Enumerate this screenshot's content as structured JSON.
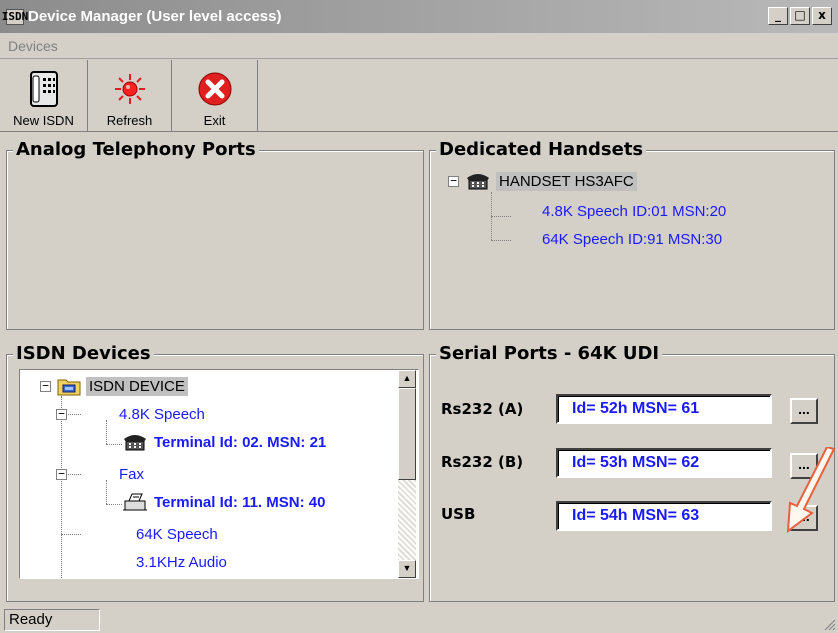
{
  "window": {
    "title": "Device Manager (User level access)",
    "app_icon": "ISDN",
    "controls": {
      "minimize": "_",
      "maximize": "□",
      "close": "x"
    }
  },
  "menu": {
    "items": [
      "Devices"
    ]
  },
  "toolbar": {
    "new_isdn": "New ISDN",
    "refresh": "Refresh",
    "exit": "Exit"
  },
  "analog": {
    "title": "Analog Telephony Ports"
  },
  "handsets": {
    "title": "Dedicated Handsets",
    "root": "HANDSET HS3AFC",
    "children": [
      "4.8K Speech ID:01 MSN:20",
      "64K Speech ID:91 MSN:30"
    ]
  },
  "isdn": {
    "title": "ISDN Devices",
    "root": "ISDN DEVICE",
    "items": [
      "4.8K Speech",
      "Terminal Id: 02.  MSN: 21",
      "Fax",
      "Terminal Id: 11.  MSN: 40",
      "64K Speech",
      "3.1KHz Audio"
    ]
  },
  "serial": {
    "title": "Serial Ports - 64K UDI",
    "ports": [
      {
        "label": "Rs232 (A)",
        "value": "Id= 52h  MSN= 61",
        "button": "..."
      },
      {
        "label": "Rs232 (B)",
        "value": "Id= 53h  MSN= 62",
        "button": "..."
      },
      {
        "label": "USB",
        "value": "Id= 54h  MSN= 63",
        "button": "..."
      }
    ]
  },
  "status": {
    "text": "Ready"
  },
  "colors": {
    "link_blue": "#1a1aff",
    "annotation_arrow": "#e8603c",
    "exit_red": "#e02020"
  }
}
